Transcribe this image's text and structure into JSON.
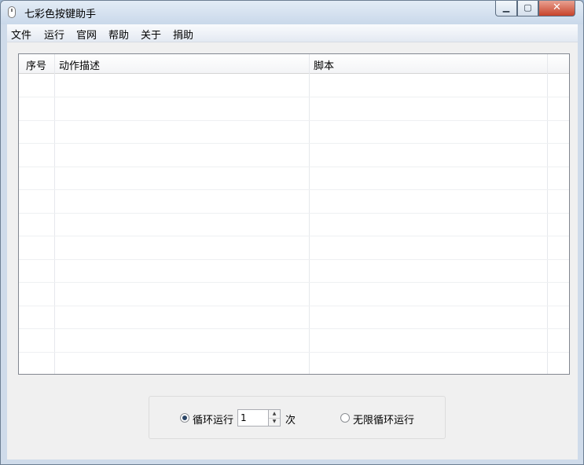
{
  "window": {
    "title": "七彩色按键助手",
    "min_glyph": "▁",
    "max_glyph": "▢",
    "close_glyph": "✕"
  },
  "menu": {
    "items": [
      "文件",
      "运行",
      "官网",
      "帮助",
      "关于",
      "捐助"
    ]
  },
  "table": {
    "columns": [
      "序号",
      "动作描述",
      "脚本"
    ],
    "rows": []
  },
  "run_options": {
    "loop_label": "循环运行",
    "loop_selected": true,
    "loop_count": "1",
    "count_unit": "次",
    "infinite_label": "无限循环运行",
    "infinite_selected": false
  }
}
